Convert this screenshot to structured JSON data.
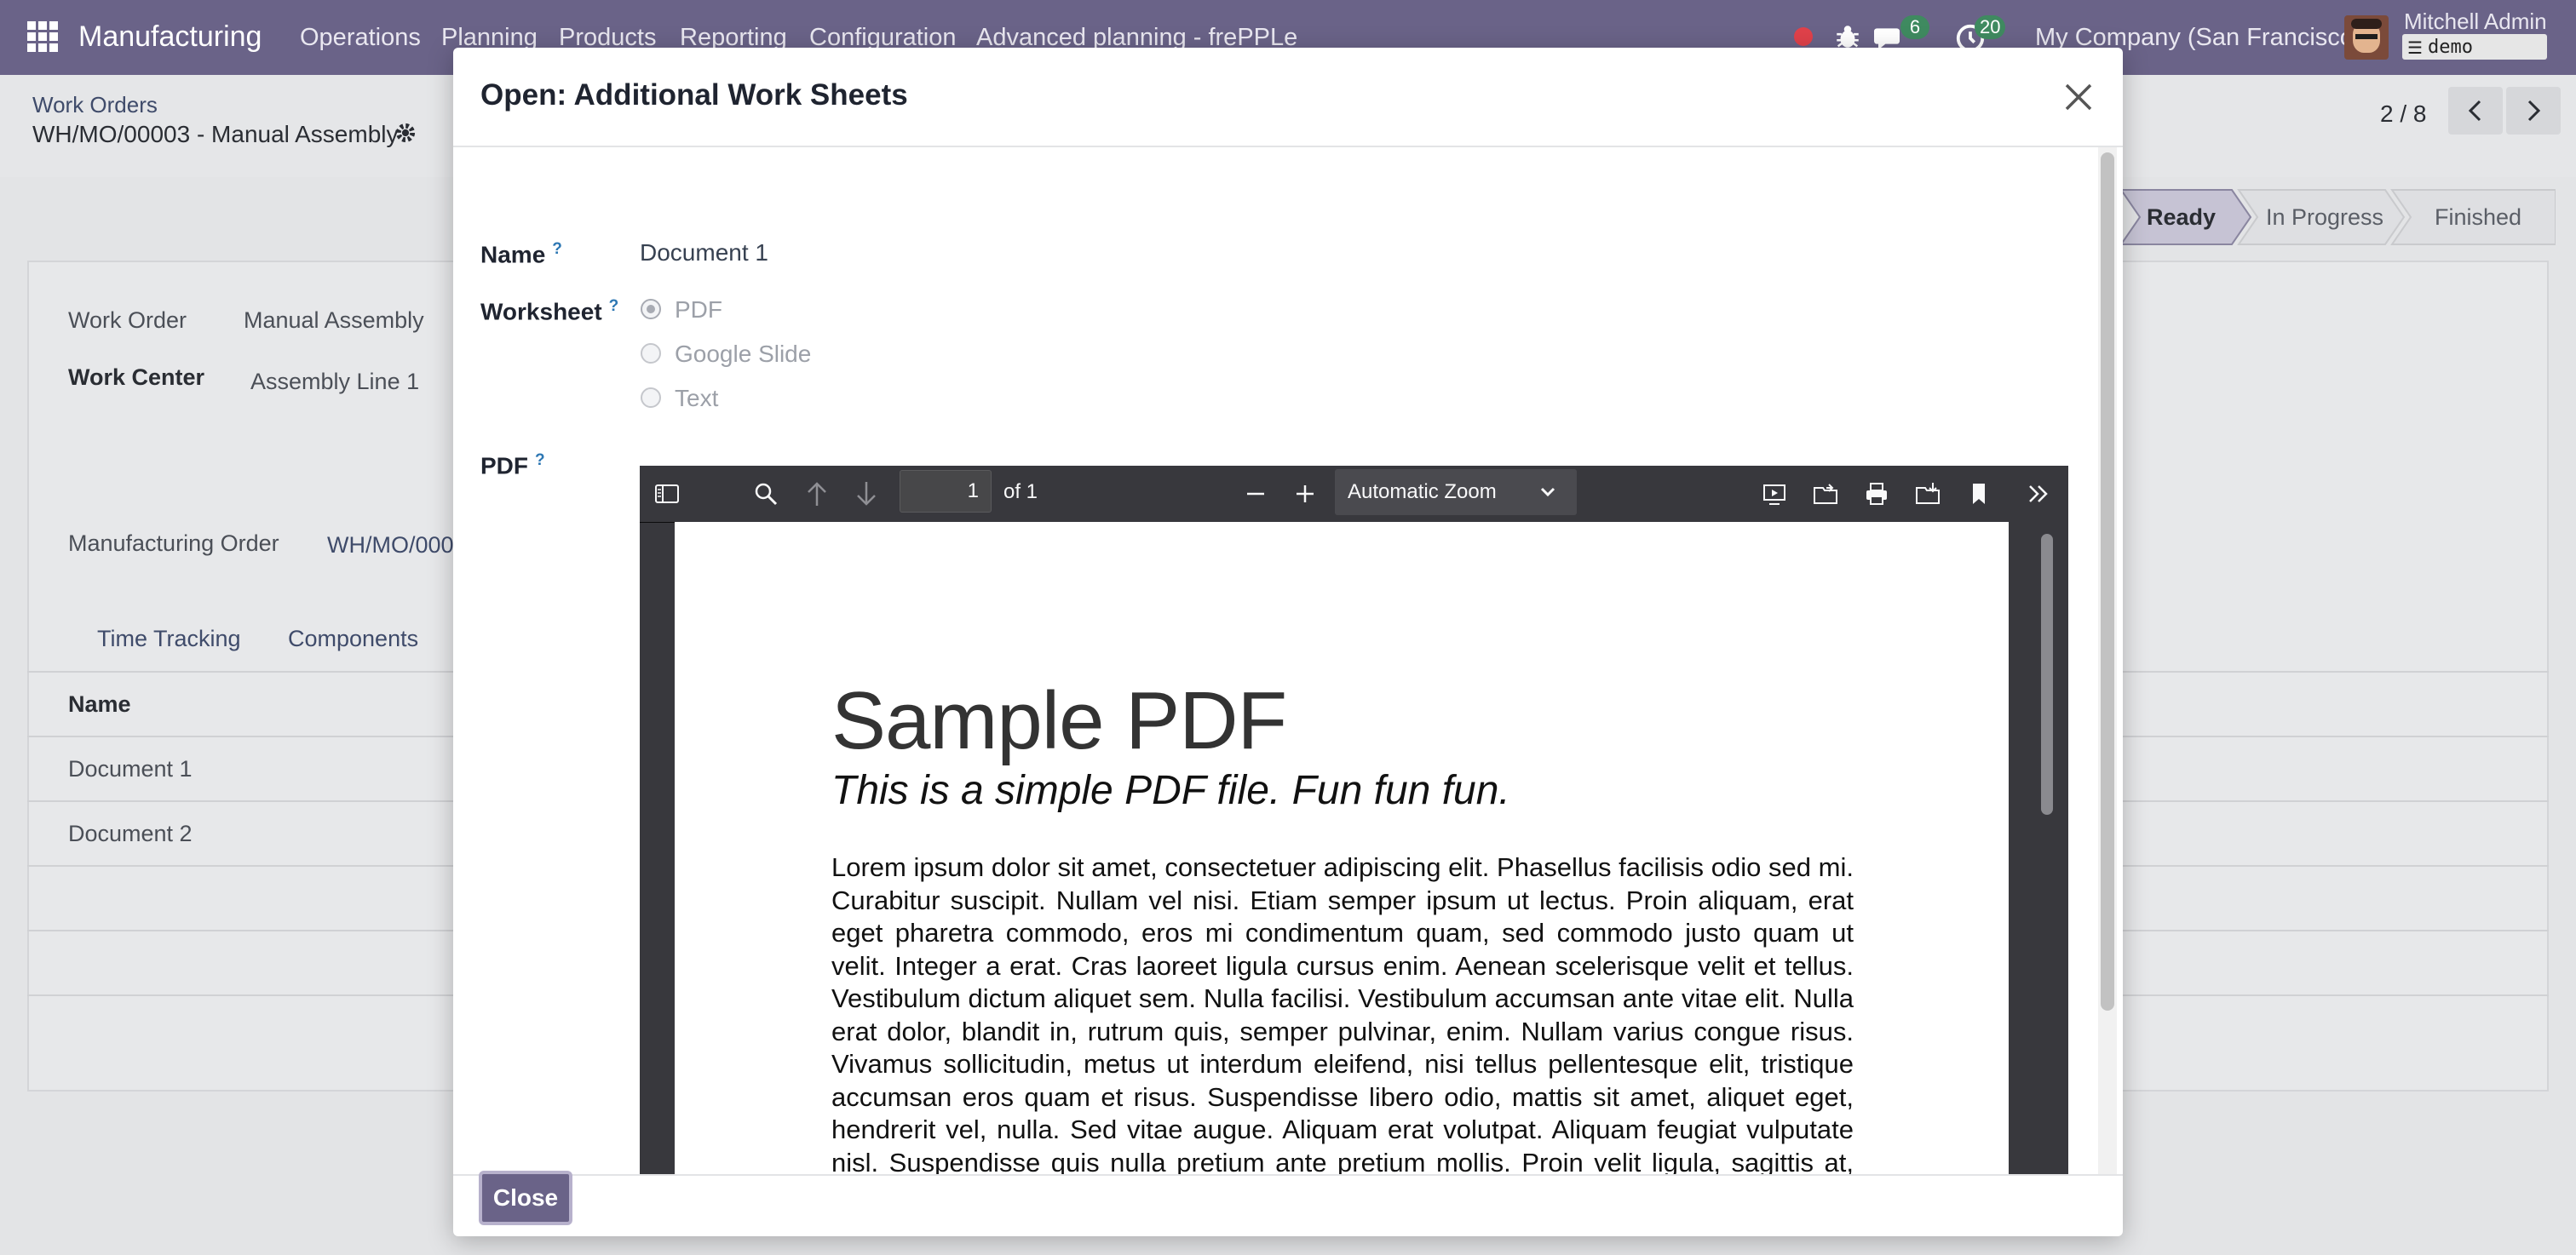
{
  "navbar": {
    "app_name": "Manufacturing",
    "menu": [
      "Operations",
      "Planning",
      "Products",
      "Reporting",
      "Configuration",
      "Advanced planning - frePPLe"
    ],
    "messages_count": "6",
    "activities_count": "20",
    "company": "My Company (San Francisco)",
    "user_name": "Mitchell Admin",
    "db_name": "demo"
  },
  "breadcrumb": {
    "parent": "Work Orders",
    "current": "WH/MO/00003 - Manual Assembly"
  },
  "pager": {
    "value": "2 / 8"
  },
  "status_steps": [
    "Ready",
    "In Progress",
    "Finished"
  ],
  "form": {
    "work_order_label": "Work Order",
    "work_order_value": "Manual Assembly",
    "work_center_label": "Work Center",
    "work_center_value": "Assembly Line 1",
    "mo_label": "Manufacturing Order",
    "mo_value": "WH/MO/000",
    "tabs": [
      "Time Tracking",
      "Components"
    ],
    "table_header": "Name",
    "rows": [
      "Document 1",
      "Document 2"
    ]
  },
  "modal": {
    "title": "Open: Additional Work Sheets",
    "name_label": "Name",
    "name_value": "Document 1",
    "worksheet_label": "Worksheet",
    "worksheet_options": [
      "PDF",
      "Google Slide",
      "Text"
    ],
    "worksheet_selected": "PDF",
    "pdf_label": "PDF",
    "close_label": "Close"
  },
  "pdf_viewer": {
    "page_number": "1",
    "page_count_label": "of 1",
    "zoom": "Automatic Zoom",
    "doc_title": "Sample PDF",
    "doc_subtitle": "This is a simple PDF file. Fun fun fun.",
    "doc_paragraph": "Lorem ipsum dolor sit amet, consectetuer adipiscing elit. Phasellus facilisis odio sed mi. Curabitur suscipit. Nullam vel nisi. Etiam semper ipsum ut lectus. Proin aliquam, erat eget pharetra commodo, eros mi condimentum quam, sed commodo justo quam ut velit. Integer a erat. Cras laoreet ligula cursus enim. Aenean scelerisque velit et tellus. Vestibulum dictum aliquet sem. Nulla facilisi. Vestibulum accumsan ante vitae elit. Nulla erat dolor, blandit in, rutrum quis, semper pulvinar, enim. Nullam varius congue risus. Vivamus sollicitudin, metus ut interdum eleifend, nisi tellus pellentesque elit, tristique accumsan eros quam et risus. Suspendisse libero odio, mattis sit amet, aliquet eget, hendrerit vel, nulla. Sed vitae augue. Aliquam erat volutpat. Aliquam feugiat vulputate nisl. Suspendisse quis nulla pretium ante pretium mollis. Proin velit ligula, sagittis at, egestas a,"
  },
  "colors": {
    "navbar": "#6a6388",
    "primary_button": "#6a6388",
    "badge": "#3f8a60",
    "help_marker": "#2d77b3"
  }
}
